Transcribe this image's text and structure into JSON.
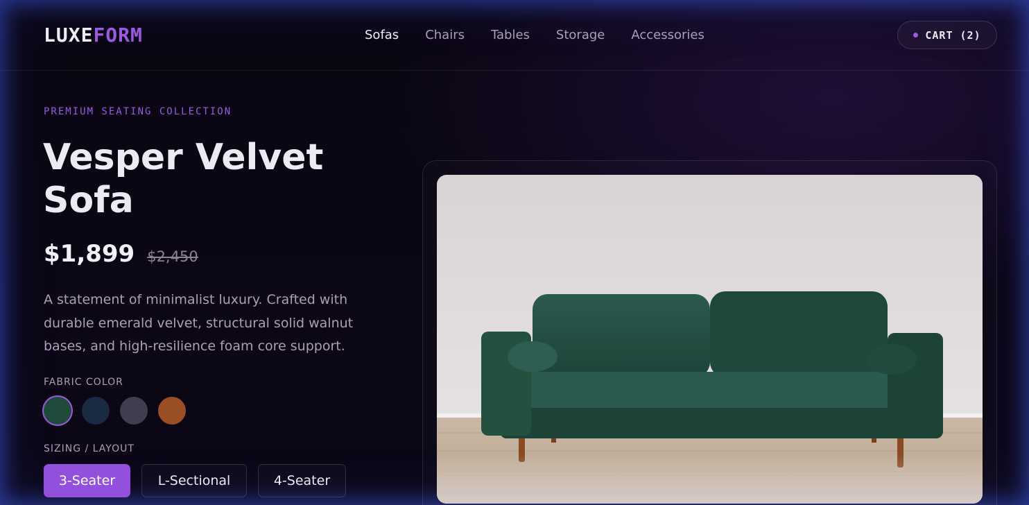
{
  "brand": {
    "part1": "LUXE",
    "part2": "FORM"
  },
  "nav": {
    "items": [
      {
        "label": "Sofas",
        "active": true
      },
      {
        "label": "Chairs",
        "active": false
      },
      {
        "label": "Tables",
        "active": false
      },
      {
        "label": "Storage",
        "active": false
      },
      {
        "label": "Accessories",
        "active": false
      }
    ]
  },
  "cart": {
    "label": "CART (2)"
  },
  "product": {
    "eyebrow": "PREMIUM SEATING COLLECTION",
    "title": "Vesper Velvet Sofa",
    "price": "$1,899",
    "original_price": "$2,450",
    "description": "A statement of minimalist luxury. Crafted with durable emerald velvet, structural solid walnut bases, and high-resilience foam core support."
  },
  "fabric": {
    "label": "FABRIC COLOR",
    "swatches": [
      {
        "color": "#1f4a3c",
        "selected": true
      },
      {
        "color": "#1a2a40",
        "selected": false
      },
      {
        "color": "#3e3e50",
        "selected": false
      },
      {
        "color": "#9a4e25",
        "selected": false
      }
    ]
  },
  "sizing": {
    "label": "SIZING / LAYOUT",
    "options": [
      {
        "label": "3-Seater",
        "selected": true
      },
      {
        "label": "L-Sectional",
        "selected": false
      },
      {
        "label": "4-Seater",
        "selected": false
      }
    ]
  },
  "colors": {
    "accent": "#9a5ae0",
    "background": "#0b0713"
  }
}
